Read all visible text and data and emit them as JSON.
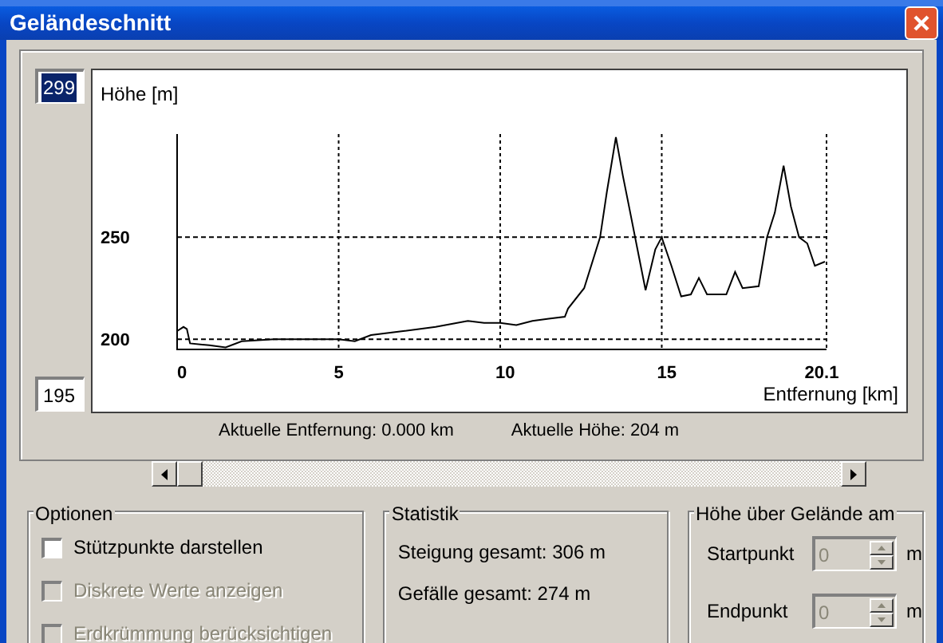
{
  "window": {
    "title": "Geländeschnitt"
  },
  "range": {
    "max_field": {
      "value": "299",
      "selected": true
    },
    "min_field": {
      "value": "195",
      "selected": false
    }
  },
  "profile": {
    "chart_data": {
      "type": "line",
      "xlabel": "Entfernung [km]",
      "ylabel": "Höhe [m]",
      "xlim": [
        0,
        20.1
      ],
      "ylim": [
        195,
        299
      ],
      "xticks": [
        0,
        5,
        10,
        15,
        {
          "value": 20.1,
          "label": "20.1"
        }
      ],
      "yticks": [
        200,
        250
      ],
      "grid": true,
      "x": [
        0,
        0.2,
        0.3,
        0.4,
        1,
        1.5,
        2,
        3,
        4,
        5,
        5.5,
        6,
        7,
        8,
        9,
        9.5,
        10,
        10.5,
        11,
        11.5,
        12,
        12.1,
        12.6,
        13.09,
        13.3,
        13.58,
        13.8,
        14.0,
        14.24,
        14.5,
        14.8,
        15.0,
        15.3,
        15.6,
        15.9,
        16.15,
        16.4,
        17.0,
        17.27,
        17.5,
        18.0,
        18.26,
        18.5,
        18.77,
        19.0,
        19.25,
        19.5,
        19.74,
        20.05
      ],
      "values": [
        204,
        206,
        205,
        198,
        197,
        196,
        199,
        200,
        200,
        200,
        199,
        202,
        204,
        206,
        209,
        208,
        208,
        207,
        209,
        210,
        211,
        215,
        225,
        250,
        272,
        299,
        280,
        264,
        245,
        224,
        244,
        250,
        236,
        221,
        222,
        230,
        222,
        222,
        233,
        225,
        226,
        250,
        262,
        285,
        265,
        250,
        247,
        236,
        238
      ]
    }
  },
  "readouts": [
    "Aktuelle Entfernung: 0.000 km",
    "Aktuelle Höhe: 204 m"
  ],
  "options": {
    "title": "Optionen",
    "items": [
      {
        "label": "Stützpunkte darstellen",
        "checked": false,
        "disabled": false
      },
      {
        "label": "Diskrete Werte anzeigen",
        "checked": false,
        "disabled": true
      },
      {
        "label": "Erdkrümmung berücksichtigen",
        "checked": false,
        "disabled": true
      }
    ]
  },
  "statistics": {
    "title": "Statistik",
    "lines": [
      "Steigung gesamt: 306 m",
      "Gefälle gesamt: 274 m"
    ]
  },
  "height_above_ground": {
    "title": "Höhe über Gelände am",
    "fields": [
      {
        "label": "Startpunkt",
        "value": "0",
        "unit": "m",
        "disabled": true
      },
      {
        "label": "Endpunkt",
        "value": "0",
        "unit": "m",
        "disabled": true
      }
    ]
  }
}
